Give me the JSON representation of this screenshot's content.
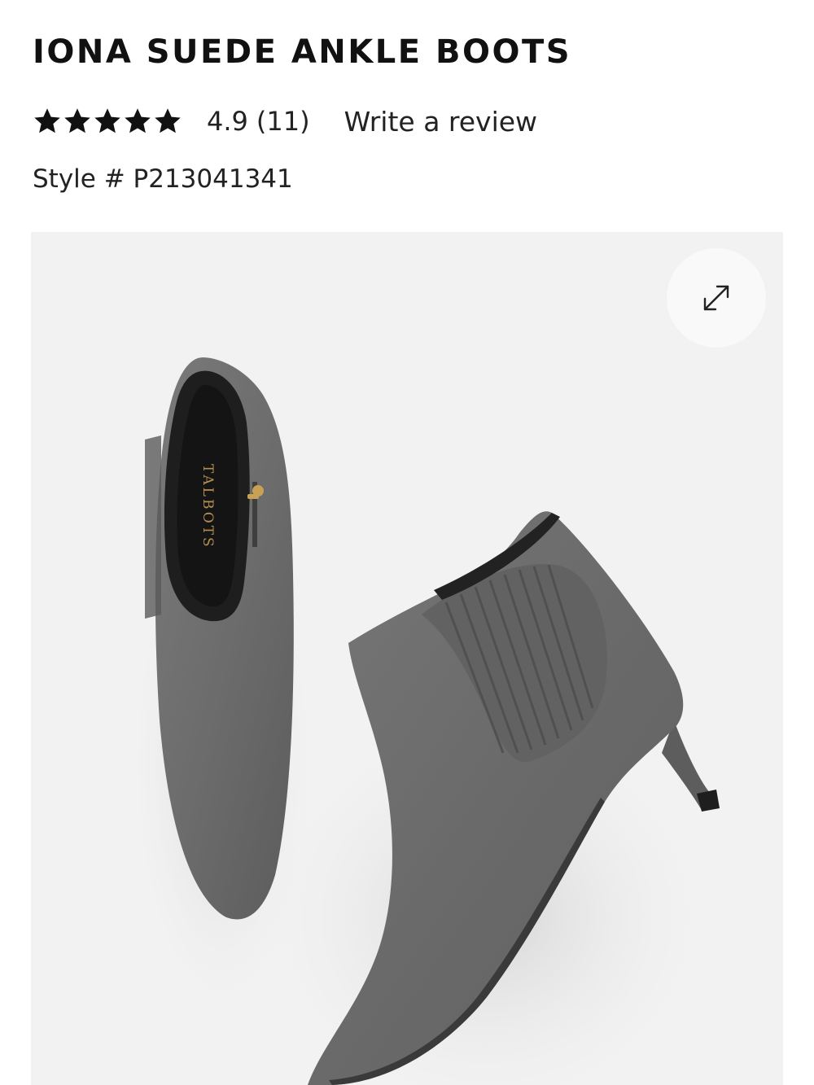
{
  "product": {
    "title": "IONA SUEDE ANKLE BOOTS",
    "rating": {
      "stars": 5,
      "value": "4.9",
      "count": "(11)",
      "write_review_label": "Write a review"
    },
    "style_number": "Style # P213041341"
  },
  "gallery": {
    "image_icon": "product-photo",
    "brand_on_insole": "TALBOTS",
    "expand_icon": "expand-arrows-icon",
    "colors": {
      "background": "#f2f2f2",
      "boot_suede": "#6f6f6f",
      "expand_button": "#f9f9f9"
    }
  }
}
